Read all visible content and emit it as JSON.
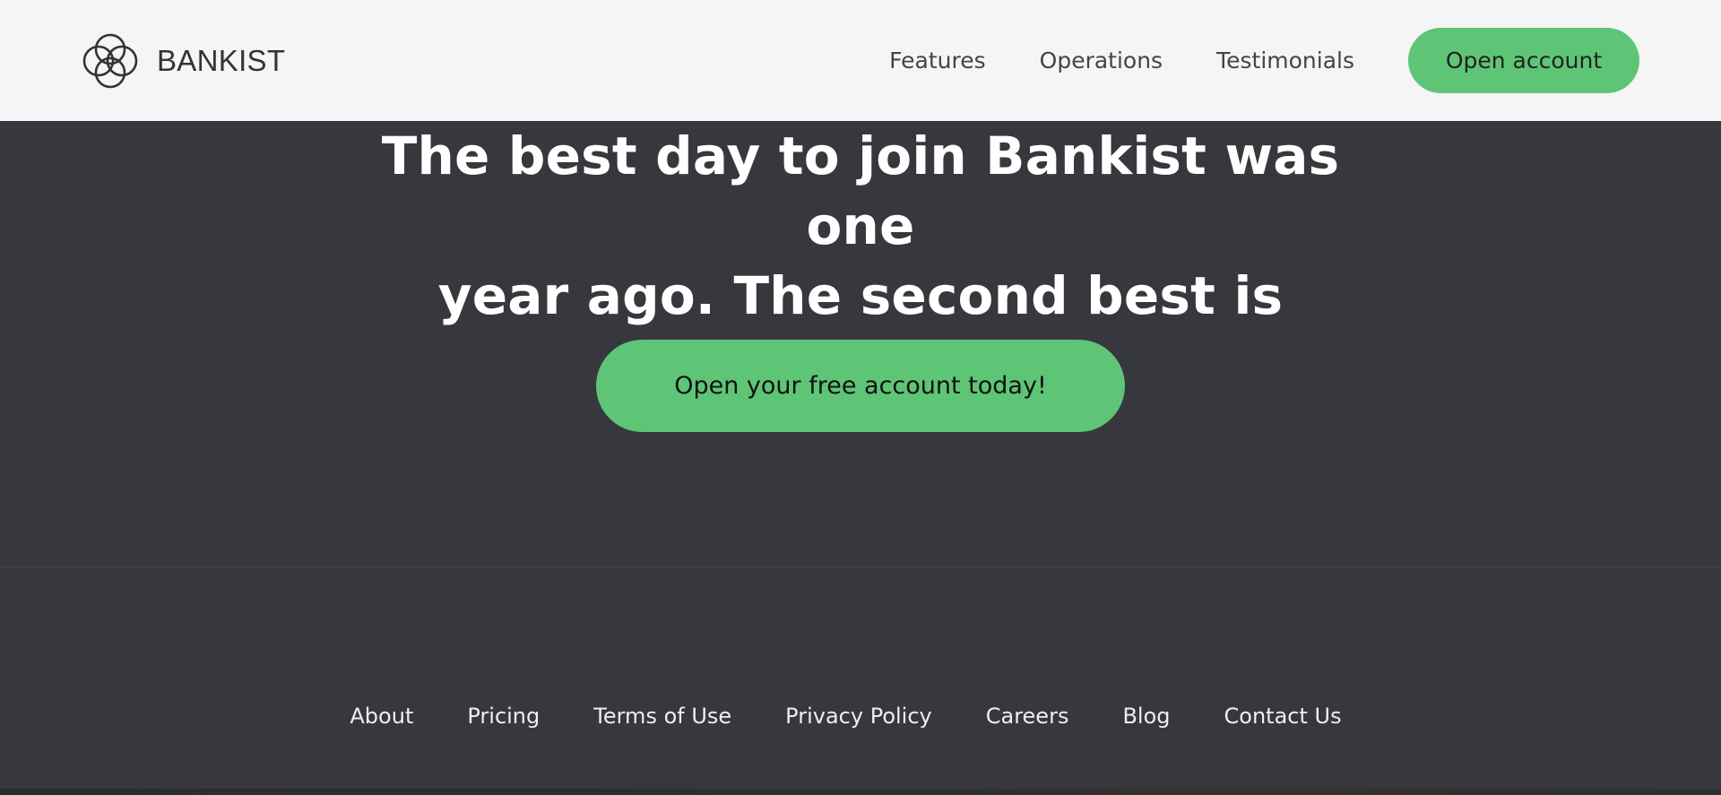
{
  "header": {
    "brand_name": "BANKIST",
    "logo_icon": "interlocking-circles-logo",
    "nav_links": [
      "Features",
      "Operations",
      "Testimonials"
    ],
    "cta_label": "Open account"
  },
  "signup": {
    "title_line1": "The best day to join Bankist was one",
    "title_line2": "year ago. The second best is today!",
    "cta_label": "Open your free account today!"
  },
  "footer": {
    "links": [
      "About",
      "Pricing",
      "Terms of Use",
      "Privacy Policy",
      "Careers",
      "Blog",
      "Contact Us"
    ]
  },
  "colors": {
    "accent_green": "#5ec576",
    "dark_background": "#37383d",
    "header_background": "#f5f5f5"
  }
}
